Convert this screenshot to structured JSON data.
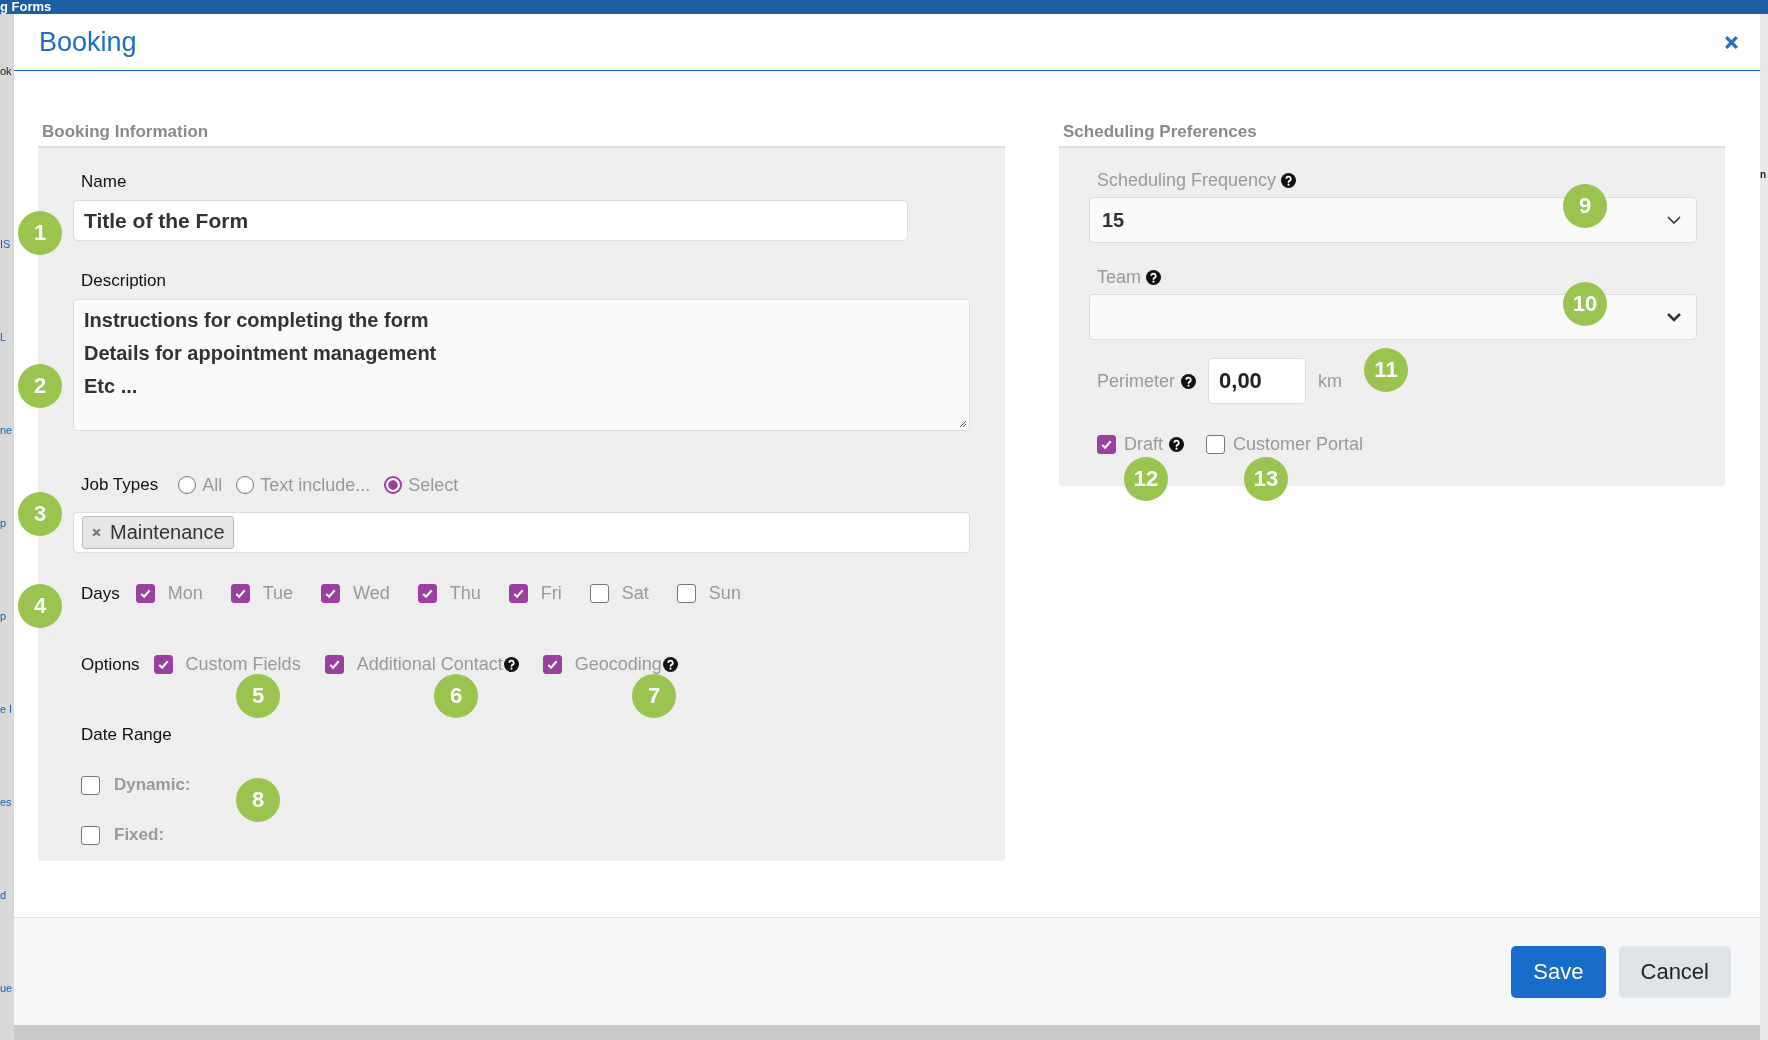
{
  "background_page": {
    "title_fragment": "g Forms",
    "left_fragments": [
      "ok",
      "IS",
      "L",
      "ne",
      "p",
      "p",
      "e l",
      "es",
      "d",
      "ue"
    ],
    "right_fragments": [
      "n"
    ]
  },
  "dialog": {
    "title": "Booking"
  },
  "booking_information": {
    "title": "Booking Information",
    "name": {
      "label": "Name",
      "value": "Title of the Form"
    },
    "description": {
      "label": "Description",
      "lines": [
        "Instructions for completing the form",
        "Details for appointment management",
        "Etc ..."
      ]
    },
    "job_types": {
      "label": "Job Types",
      "options": [
        {
          "label": "All",
          "selected": false
        },
        {
          "label": "Text include...",
          "selected": false
        },
        {
          "label": "Select",
          "selected": true
        }
      ],
      "tags": [
        "Maintenance"
      ]
    },
    "days": {
      "label": "Days",
      "items": [
        {
          "label": "Mon",
          "checked": true
        },
        {
          "label": "Tue",
          "checked": true
        },
        {
          "label": "Wed",
          "checked": true
        },
        {
          "label": "Thu",
          "checked": true
        },
        {
          "label": "Fri",
          "checked": true
        },
        {
          "label": "Sat",
          "checked": false
        },
        {
          "label": "Sun",
          "checked": false
        }
      ]
    },
    "options": {
      "label": "Options",
      "items": [
        {
          "label": "Custom Fields",
          "checked": true,
          "help": false
        },
        {
          "label": "Additional Contact",
          "checked": true,
          "help": true
        },
        {
          "label": "Geocoding",
          "checked": true,
          "help": true
        }
      ]
    },
    "date_range": {
      "label": "Date Range",
      "items": [
        {
          "label": "Dynamic:",
          "checked": false
        },
        {
          "label": "Fixed:",
          "checked": false
        }
      ]
    }
  },
  "scheduling_preferences": {
    "title": "Scheduling Preferences",
    "frequency": {
      "label": "Scheduling Frequency",
      "value": "15"
    },
    "team": {
      "label": "Team"
    },
    "perimeter": {
      "label": "Perimeter",
      "value": "0,00",
      "unit": "km"
    },
    "flags": [
      {
        "label": "Draft",
        "checked": true,
        "help": true
      },
      {
        "label": "Customer Portal",
        "checked": false,
        "help": false
      }
    ]
  },
  "callouts": [
    "1",
    "2",
    "3",
    "4",
    "5",
    "6",
    "7",
    "8",
    "9",
    "10",
    "11",
    "12",
    "13"
  ],
  "buttons": [
    {
      "label": "Save",
      "kind": "primary"
    },
    {
      "label": "Cancel",
      "kind": "secondary"
    }
  ]
}
